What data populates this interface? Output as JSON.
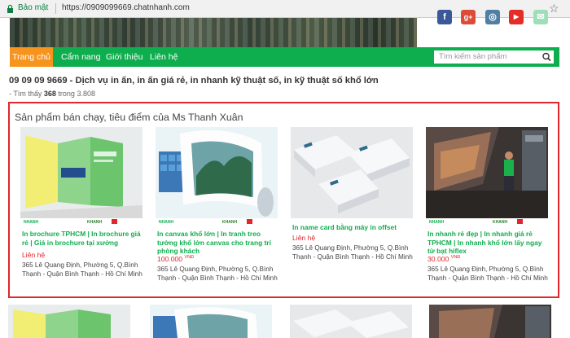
{
  "browser": {
    "secure_label": "Bảo mật",
    "url": "https://0909099669.chatnhanh.com"
  },
  "nav": {
    "home": "Trang chủ",
    "guide": "Cẩm nang",
    "about": "Giới thiệu",
    "contact": "Liên hệ"
  },
  "search": {
    "placeholder": "Tìm kiếm sản phẩm"
  },
  "page_title": "09 09 09 9669 - Dịch vụ in ấn, in ấn giá rẻ, in nhanh kỹ thuật số, in kỹ thuật số khổ lớn",
  "result": {
    "prefix": "- Tìm thấy",
    "found": "368",
    "middle": "trong",
    "total": "3.808"
  },
  "featured": {
    "heading": "Sản phẩm bán chạy, tiêu điểm của Ms Thanh Xuân",
    "logo_text": "NHANH",
    "logo_text2": "KHANH",
    "products": [
      {
        "name": "In brochure TPHCM | In brochure giá rẻ | Giá in brochure tại xưởng",
        "price": "Liên hệ",
        "price_unit": "",
        "address": "365 Lê Quang Định, Phường 5, Q.Bình Thạnh - Quận Bình Thạnh - Hồ Chí Minh"
      },
      {
        "name": "In canvas khổ lớn | In tranh treo tường khổ lớn canvas cho trang trí phòng khách",
        "price": "100.000",
        "price_unit": "VNĐ",
        "address": "365 Lê Quang Định, Phường 5, Q.Bình Thạnh - Quận Bình Thạnh - Hồ Chí Minh"
      },
      {
        "name": "In name card bằng máy in offset",
        "price": "Liên hệ",
        "price_unit": "",
        "address": "365 Lê Quang Định, Phường 5, Q.Bình Thạnh - Quận Bình Thạnh - Hồ Chí Minh"
      },
      {
        "name": "In nhanh rẻ đẹp | In nhanh giá rẻ TPHCM | In nhanh khổ lớn lấy ngay từ bạt hiflex",
        "price": "30.000",
        "price_unit": "VNĐ",
        "address": "365 Lê Quang Định, Phường 5, Q.Bình Thạnh - Quận Bình Thạnh - Hồ Chí Minh"
      }
    ]
  },
  "social": [
    "f",
    "g+",
    "◎",
    "▶",
    "✉"
  ],
  "colors": {
    "accent_green": "#0eae4e",
    "accent_orange": "#f7941d",
    "highlight_red": "#e1262c"
  }
}
